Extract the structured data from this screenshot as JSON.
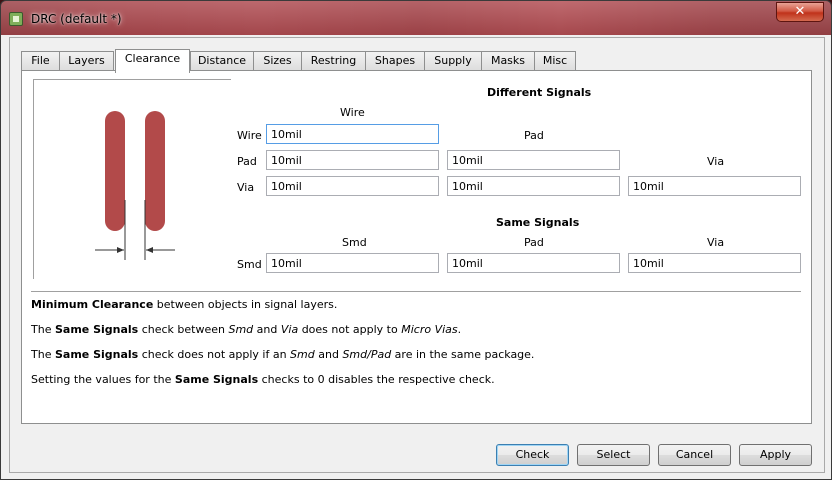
{
  "window": {
    "title": "DRC (default *)",
    "close_symbol": "✕"
  },
  "tabs": [
    {
      "label": "File"
    },
    {
      "label": "Layers"
    },
    {
      "label": "Clearance"
    },
    {
      "label": "Distance"
    },
    {
      "label": "Sizes"
    },
    {
      "label": "Restring"
    },
    {
      "label": "Shapes"
    },
    {
      "label": "Supply"
    },
    {
      "label": "Masks"
    },
    {
      "label": "Misc"
    }
  ],
  "active_tab": "Clearance",
  "different_signals": {
    "title": "Different Signals",
    "col_wire": "Wire",
    "col_pad": "Pad",
    "col_via": "Via",
    "row_wire": "Wire",
    "row_pad": "Pad",
    "row_via": "Via",
    "wire_wire": "10mil",
    "pad_wire": "10mil",
    "pad_pad": "10mil",
    "via_wire": "10mil",
    "via_pad": "10mil",
    "via_via": "10mil"
  },
  "same_signals": {
    "title": "Same Signals",
    "col_smd": "Smd",
    "col_pad": "Pad",
    "col_via": "Via",
    "row_smd": "Smd",
    "smd_smd": "10mil",
    "smd_pad": "10mil",
    "smd_via": "10mil"
  },
  "info": {
    "line1_b": "Minimum Clearance",
    "line1_rest": " between objects in signal layers.",
    "line2_a": "The ",
    "line2_b": "Same Signals",
    "line2_c": " check between ",
    "line2_i1": "Smd",
    "line2_d": " and ",
    "line2_i2": "Via",
    "line2_e": " does not apply to ",
    "line2_i3": "Micro Vias",
    "line2_f": ".",
    "line3_a": "The ",
    "line3_b": "Same Signals",
    "line3_c": " check does not apply if an ",
    "line3_i1": "Smd",
    "line3_d": " and ",
    "line3_i2": "Smd/Pad",
    "line3_e": " are in the same package.",
    "line4_a": "Setting the values for the ",
    "line4_b": "Same Signals",
    "line4_c": " checks to 0 disables the respective check."
  },
  "buttons": {
    "check": "Check",
    "select": "Select",
    "cancel": "Cancel",
    "apply": "Apply"
  },
  "colors": {
    "wire_fill": "#b24a4a",
    "accent_focus": "#569de5"
  }
}
